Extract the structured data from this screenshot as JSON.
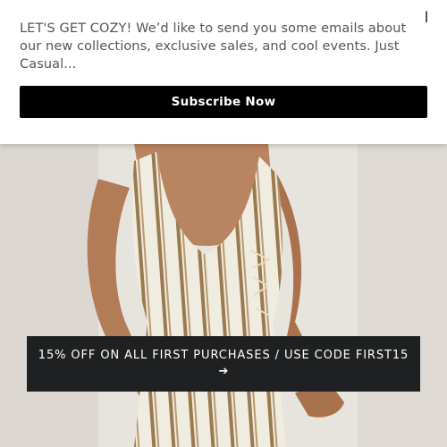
{
  "popup": {
    "message": "LET'S GET COZY! We’d like to send you some emails about our new collections, exclusive sales, and cool events. Just Casual...",
    "close_label": "I",
    "subscribe_label": "Subscribe Now"
  },
  "promo": {
    "text": "15% OFF ON ALL FIRST PURCHASES / USE CODE FIRST15",
    "arrow": "➔"
  },
  "colors": {
    "popup_bg": "#ffffff",
    "button_bg": "#000000",
    "banner_bg": "#1f2021",
    "dress_stripe": "#9a7a4f",
    "dress_base": "#f1ece0"
  }
}
